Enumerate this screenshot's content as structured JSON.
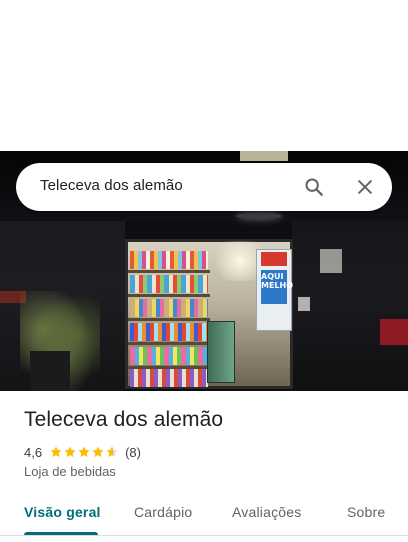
{
  "search": {
    "query": "Teleceva dos alemão",
    "search_icon": "search-icon",
    "close_icon": "close-icon"
  },
  "photo": {
    "sign_text": "AQUI MELHO"
  },
  "place": {
    "name": "Teleceva dos alemão",
    "rating": "4,6",
    "rating_value": 4.6,
    "review_count": "(8)",
    "category": "Loja de bebidas"
  },
  "tabs": [
    {
      "label": "Visão geral",
      "active": true
    },
    {
      "label": "Cardápio",
      "active": false
    },
    {
      "label": "Avaliações",
      "active": false
    },
    {
      "label": "Sobre",
      "active": false
    }
  ],
  "colors": {
    "accent": "#006d77",
    "star": "#fbbc04",
    "star_empty": "#dadce0"
  }
}
